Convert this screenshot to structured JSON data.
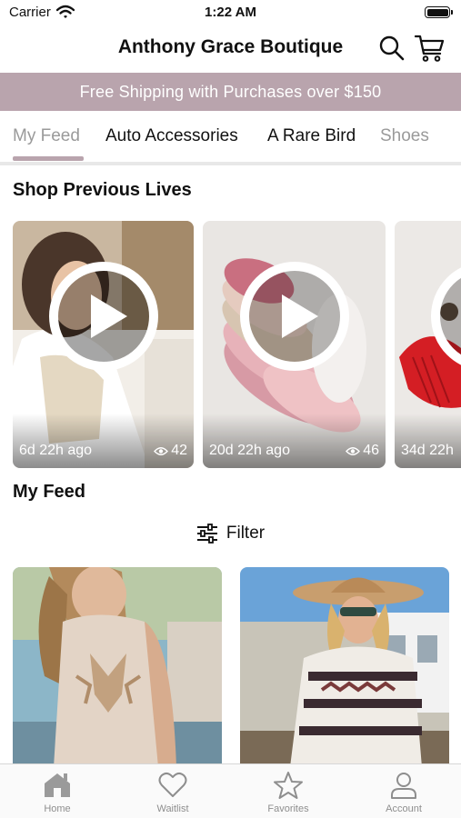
{
  "status_bar": {
    "carrier": "Carrier",
    "time": "1:22 AM"
  },
  "header": {
    "title": "Anthony Grace Boutique",
    "icons": [
      "search-icon",
      "cart-icon"
    ]
  },
  "promo_banner": {
    "text": "Free Shipping with Purchases over $150"
  },
  "tabs": [
    {
      "label": "My Feed",
      "active": true
    },
    {
      "label": "Auto Accessories",
      "active": false
    },
    {
      "label": "A Rare Bird",
      "active": false
    },
    {
      "label": "Shoes",
      "active": false
    }
  ],
  "shop_previous_lives": {
    "title": "Shop Previous Lives",
    "cards": [
      {
        "age": "6d 22h ago",
        "views": "42"
      },
      {
        "age": "20d 22h ago",
        "views": "46"
      },
      {
        "age": "34d 22h",
        "views": ""
      }
    ]
  },
  "my_feed": {
    "title": "My Feed",
    "filter_label": "Filter"
  },
  "tab_bar": [
    {
      "label": "Home",
      "icon": "home-icon",
      "active": true
    },
    {
      "label": "Waitlist",
      "icon": "heart-icon",
      "active": false
    },
    {
      "label": "Favorites",
      "icon": "star-icon",
      "active": false
    },
    {
      "label": "Account",
      "icon": "person-icon",
      "active": false
    }
  ],
  "colors": {
    "accent": "#b9a4ad",
    "text": "#111111",
    "muted": "#8e8e8e"
  }
}
